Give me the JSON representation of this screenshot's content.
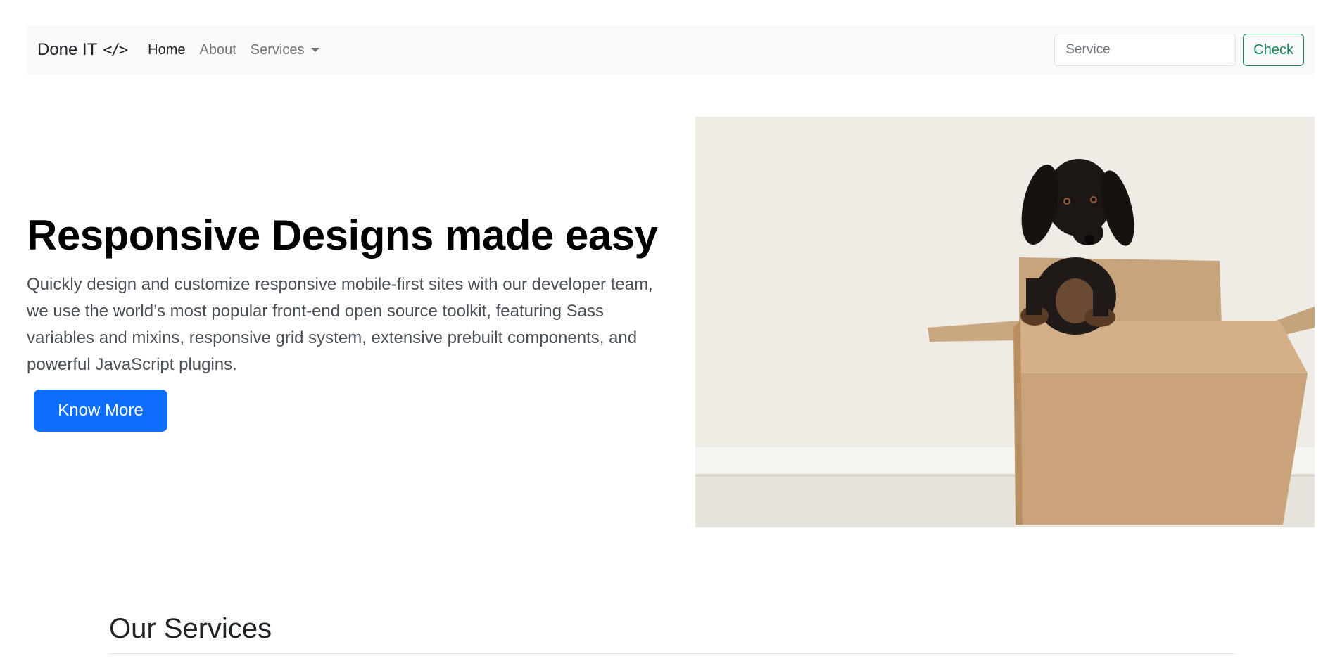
{
  "navbar": {
    "brand": "Done IT",
    "brand_icon": "</>",
    "links": [
      {
        "label": "Home"
      },
      {
        "label": "About"
      },
      {
        "label": "Services"
      }
    ],
    "search": {
      "placeholder": "Service"
    },
    "check_label": "Check"
  },
  "hero": {
    "title": "Responsive Designs made easy",
    "lead": "Quickly design and customize responsive mobile-first sites with our developer team, we use the world’s most popular front-end open source toolkit, featuring Sass variables and mixins, responsive grid system, extensive prebuilt components, and powerful JavaScript plugins.",
    "button_label": "Know More",
    "image_icon": "dog-in-box-photo"
  },
  "services": {
    "title": "Our Services"
  },
  "colors": {
    "primary": "#0d6efd",
    "success": "#198754",
    "navbar_bg": "#f8f9fa"
  }
}
